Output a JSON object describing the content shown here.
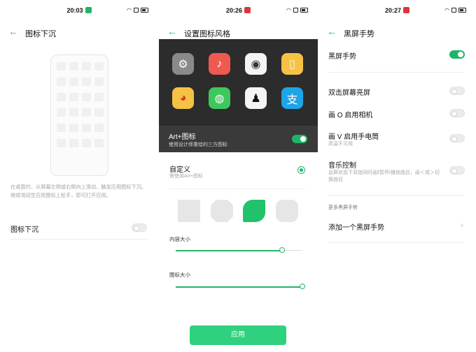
{
  "screen1": {
    "time": "20:03",
    "title": "图标下沉",
    "description": "在桌面时，从屏幕左侧或右侧向上滑动，触发应用图标下沉。继续滑动至应用图标上松手，即可打开应用。",
    "option_label": "图标下沉",
    "option_enabled": false,
    "badge_color": "#20b566"
  },
  "screen2": {
    "time": "20:26",
    "title": "设置图标风格",
    "art_title": "Art+图标",
    "art_sub": "使用设计师重绘的三方图标",
    "art_enabled": true,
    "custom_title": "自定义",
    "custom_sub": "需使用Art+图标",
    "content_size_label": "内容大小",
    "icon_size_label": "图标大小",
    "content_size_value": 0.84,
    "icon_size_value": 1.0,
    "apply_label": "应用",
    "badge_color": "#e0343a",
    "app_icons": [
      "gear-icon",
      "music-icon",
      "camera-icon",
      "notes-icon",
      "weibo-icon",
      "wechat-icon",
      "qq-icon",
      "alipay-icon"
    ]
  },
  "screen3": {
    "time": "20:27",
    "title": "黑屏手势",
    "main_label": "黑屏手势",
    "main_enabled": true,
    "items": [
      {
        "label": "双击屏幕亮屏",
        "sub": "",
        "enabled": false
      },
      {
        "label": "画 O 启用相机",
        "sub": "",
        "enabled": false
      },
      {
        "label": "画 V 启用手电筒",
        "sub": "高温不可用",
        "enabled": false
      },
      {
        "label": "音乐控制",
        "sub": "息屏状态下双指同时画‖暂停/播放曲目，画＜或＞切换曲目",
        "enabled": false
      }
    ],
    "section_label": "更多黑屏手势",
    "add_label": "添加一个黑屏手势",
    "badge_color": "#e0343a"
  },
  "accent_color": "#20b566"
}
